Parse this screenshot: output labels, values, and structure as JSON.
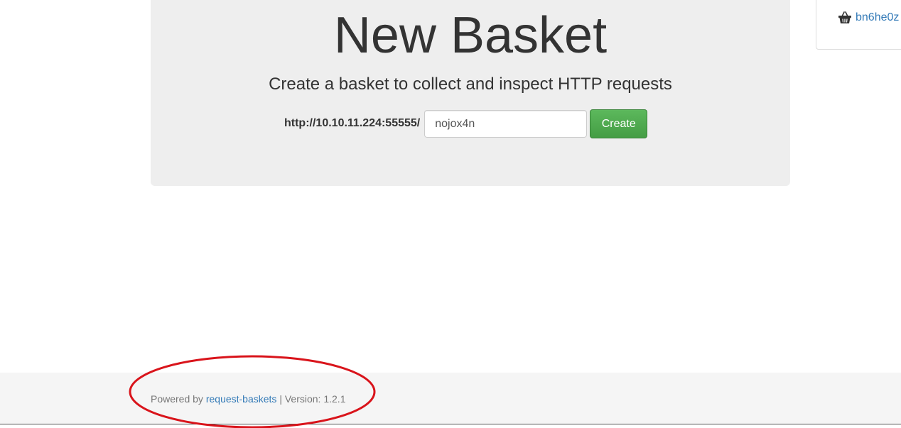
{
  "main": {
    "title": "New Basket",
    "subtitle": "Create a basket to collect and inspect HTTP requests",
    "base_url": "http://10.10.11.224:55555/",
    "basket_name_value": "nojox4n",
    "create_label": "Create"
  },
  "sidebar": {
    "baskets": [
      {
        "name": "bn6he0z",
        "icon": "basket-icon"
      }
    ]
  },
  "footer": {
    "powered_by": "Powered by",
    "project_link": "request-baskets",
    "separator": "|",
    "version_label": "Version:",
    "version": "1.2.1"
  },
  "colors": {
    "accent": "#337ab7",
    "success": "#5cb85c",
    "annotation": "#d9141b",
    "jumbotron_bg": "#eeeeee",
    "footer_bg": "#f5f5f5"
  }
}
